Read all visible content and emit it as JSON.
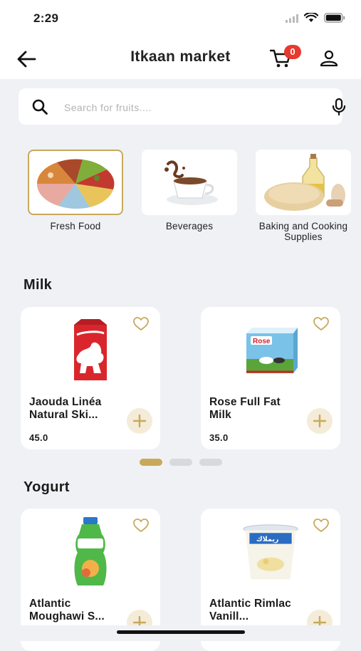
{
  "status": {
    "time": "2:29"
  },
  "header": {
    "title": "Itkaan market",
    "cart_count": "0"
  },
  "search": {
    "placeholder": "Search for fruits...."
  },
  "categories": [
    {
      "label": "Fresh Food",
      "selected": true
    },
    {
      "label": "Beverages",
      "selected": false
    },
    {
      "label": "Baking and Cooking Supplies",
      "selected": false
    }
  ],
  "sections": [
    {
      "title": "Milk",
      "products": [
        {
          "name": "Jaouda Linéa Natural Ski...",
          "price": "45.0"
        },
        {
          "name": "Rose Full Fat Milk",
          "price": "35.0"
        }
      ]
    },
    {
      "title": "Yogurt",
      "products": [
        {
          "name": "Atlantic Moughawi S...",
          "price": ""
        },
        {
          "name": "Atlantic Rimlac Vanill...",
          "price": ""
        }
      ]
    }
  ],
  "pager": {
    "pages": 3,
    "active": 0
  },
  "colors": {
    "accent": "#c8a95a",
    "badge": "#e8392f",
    "background": "#eff1f5"
  }
}
